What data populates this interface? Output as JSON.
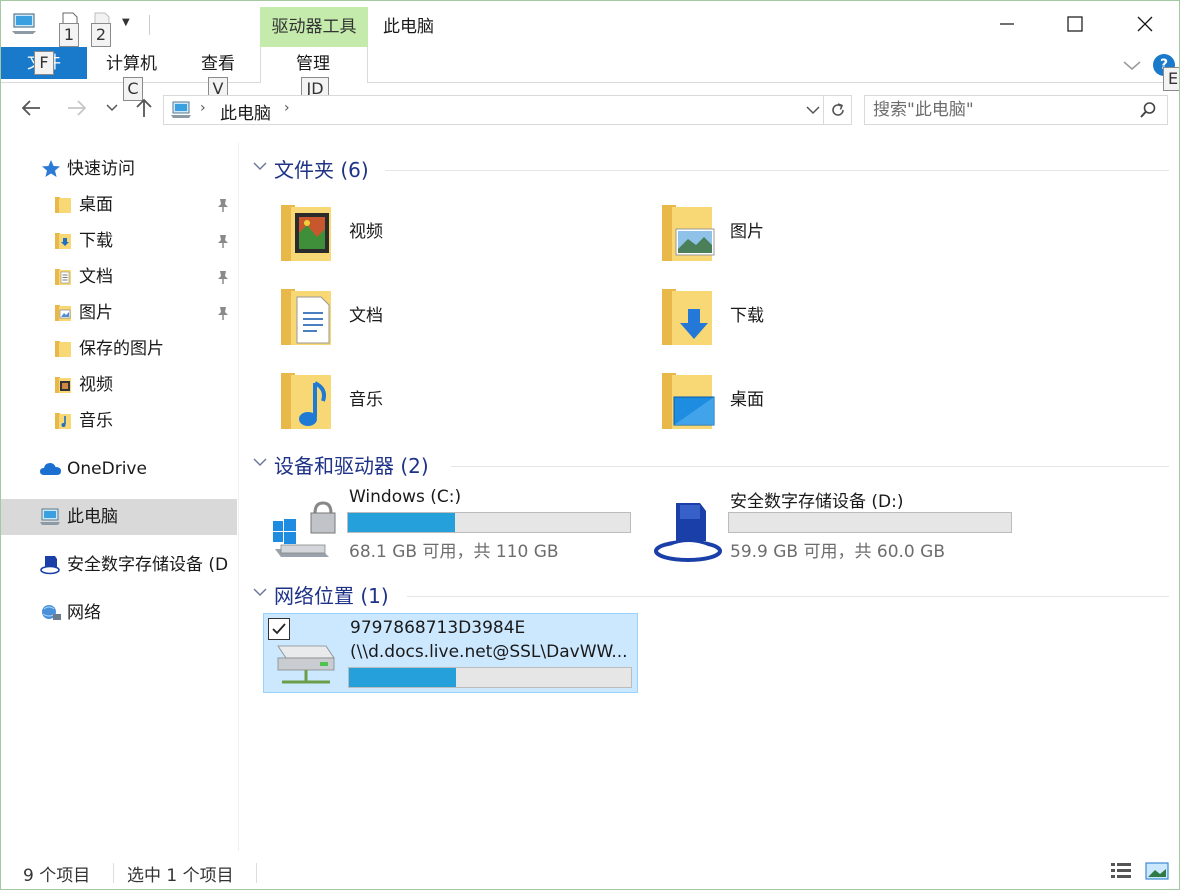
{
  "titlebar": {
    "title": "此电脑",
    "tool_tab": "驱动器工具",
    "keytips": {
      "qa1": "1",
      "qa2": "2",
      "file": "F",
      "computer": "C",
      "view": "V",
      "manage": "JD",
      "help": "E"
    }
  },
  "ribbon": {
    "file": "文件",
    "tabs": [
      {
        "label": "计算机"
      },
      {
        "label": "查看"
      },
      {
        "label": "管理"
      }
    ],
    "help": "?"
  },
  "address": {
    "path": "此电脑",
    "search_placeholder": "搜索\"此电脑\""
  },
  "sidebar": {
    "items": [
      {
        "label": "快速访问",
        "icon": "star-icon"
      },
      {
        "label": "桌面",
        "icon": "folder-icon",
        "pinned": true
      },
      {
        "label": "下载",
        "icon": "download-folder-icon",
        "pinned": true
      },
      {
        "label": "文档",
        "icon": "document-folder-icon",
        "pinned": true
      },
      {
        "label": "图片",
        "icon": "picture-folder-icon",
        "pinned": true
      },
      {
        "label": "保存的图片",
        "icon": "folder-icon"
      },
      {
        "label": "视频",
        "icon": "video-folder-icon"
      },
      {
        "label": "音乐",
        "icon": "music-folder-icon"
      },
      {
        "label": "OneDrive",
        "icon": "cloud-icon"
      },
      {
        "label": "此电脑",
        "icon": "computer-icon",
        "selected": true
      },
      {
        "label": "安全数字存储设备 (D",
        "icon": "sd-card-icon"
      },
      {
        "label": "网络",
        "icon": "network-icon"
      }
    ]
  },
  "groups": {
    "folders": {
      "title": "文件夹 (6)"
    },
    "devices": {
      "title": "设备和驱动器 (2)"
    },
    "network": {
      "title": "网络位置 (1)"
    }
  },
  "folders": [
    {
      "label": "视频",
      "icon": "video-folder-icon"
    },
    {
      "label": "图片",
      "icon": "picture-folder-icon"
    },
    {
      "label": "文档",
      "icon": "document-folder-icon"
    },
    {
      "label": "下载",
      "icon": "download-folder-icon"
    },
    {
      "label": "音乐",
      "icon": "music-folder-icon"
    },
    {
      "label": "桌面",
      "icon": "desktop-folder-icon"
    }
  ],
  "drives": [
    {
      "name": "Windows (C:)",
      "free": "68.1 GB 可用，共 110 GB",
      "used_fraction": 0.38,
      "icon": "windows-drive-icon"
    },
    {
      "name": "安全数字存储设备 (D:)",
      "free": "59.9 GB 可用，共 60.0 GB",
      "used_fraction": 0.0,
      "icon": "sd-card-icon"
    }
  ],
  "network_locations": [
    {
      "name": "9797868713D3984E",
      "path": "(\\\\d.docs.live.net@SSL\\DavWW...",
      "used_fraction": 0.38,
      "checked": true,
      "icon": "network-drive-icon"
    }
  ],
  "status": {
    "count": "9 个项目",
    "selected": "选中 1 个项目"
  },
  "colors": {
    "accent": "#1979ca",
    "tool_tab": "#c4ebac",
    "group_title": "#1e3287",
    "bar_fill": "#26a0da",
    "selection": "#cce8ff"
  }
}
